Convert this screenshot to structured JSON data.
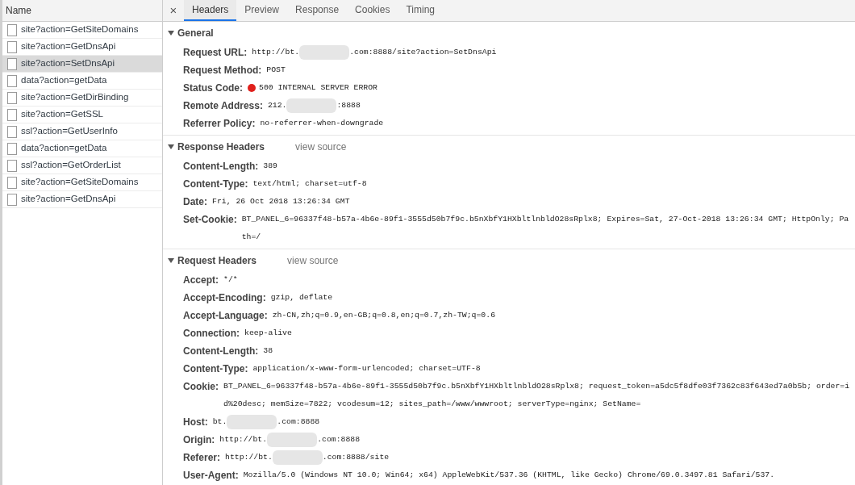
{
  "requests": {
    "header": "Name",
    "items": [
      {
        "name": "site?action=GetSiteDomains",
        "selected": false
      },
      {
        "name": "site?action=GetDnsApi",
        "selected": false
      },
      {
        "name": "site?action=SetDnsApi",
        "selected": true
      },
      {
        "name": "data?action=getData",
        "selected": false
      },
      {
        "name": "site?action=GetDirBinding",
        "selected": false
      },
      {
        "name": "site?action=GetSSL",
        "selected": false
      },
      {
        "name": "ssl?action=GetUserInfo",
        "selected": false
      },
      {
        "name": "data?action=getData",
        "selected": false
      },
      {
        "name": "ssl?action=GetOrderList",
        "selected": false
      },
      {
        "name": "site?action=GetSiteDomains",
        "selected": false
      },
      {
        "name": "site?action=GetDnsApi",
        "selected": false
      }
    ]
  },
  "close": "×",
  "tabs": [
    {
      "label": "Headers",
      "selected": true
    },
    {
      "label": "Preview",
      "selected": false
    },
    {
      "label": "Response",
      "selected": false
    },
    {
      "label": "Cookies",
      "selected": false
    },
    {
      "label": "Timing",
      "selected": false
    }
  ],
  "sections": [
    {
      "title": "General",
      "expanded": true,
      "headers": [
        {
          "name": "Request URL:",
          "parts": [
            "http://bt.",
            ".com:8888/site?action=SetDnsApi"
          ]
        },
        {
          "name": "Request Method:",
          "parts": [
            "POST"
          ]
        },
        {
          "name": "Status Code:",
          "color": "#e0201c",
          "parts": [
            "500 INTERNAL SERVER ERROR"
          ]
        },
        {
          "name": "Remote Address:",
          "parts": [
            "212.",
            ":8888"
          ]
        },
        {
          "name": "Referrer Policy:",
          "parts": [
            "no-referrer-when-downgrade"
          ]
        }
      ]
    },
    {
      "title": "Response Headers",
      "link": "view source",
      "expanded": true,
      "headers": [
        {
          "name": "Content-Length:",
          "parts": [
            "389"
          ]
        },
        {
          "name": "Content-Type:",
          "parts": [
            "text/html; charset=utf-8"
          ]
        },
        {
          "name": "Date:",
          "parts": [
            "Fri, 26 Oct 2018 13:26:34 GMT"
          ]
        },
        {
          "name": "Set-Cookie:",
          "parts": [
            "BT_PANEL_6=96337f48-b57a-4b6e-89f1-3555d50b7f9c.b5nXbfY1HXbltlnbldO28sRplx8; Expires=Sat, 27-Oct-2018 13:26:34 GMT; HttpOnly; Path=/"
          ]
        }
      ]
    },
    {
      "title": "Request Headers",
      "link": "view source",
      "expanded": true,
      "headers": [
        {
          "name": "Accept:",
          "parts": [
            "*/*"
          ]
        },
        {
          "name": "Accept-Encoding:",
          "parts": [
            "gzip, deflate"
          ]
        },
        {
          "name": "Accept-Language:",
          "parts": [
            "zh-CN,zh;q=0.9,en-GB;q=0.8,en;q=0.7,zh-TW;q=0.6"
          ]
        },
        {
          "name": "Connection:",
          "parts": [
            "keep-alive"
          ]
        },
        {
          "name": "Content-Length:",
          "parts": [
            "38"
          ]
        },
        {
          "name": "Content-Type:",
          "parts": [
            "application/x-www-form-urlencoded; charset=UTF-8"
          ]
        },
        {
          "name": "Cookie:",
          "parts": [
            "BT_PANEL_6=96337f48-b57a-4b6e-89f1-3555d50b7f9c.b5nXbfY1HXbltlnbldO28sRplx8; request_token=a5dc5f8dfe03f7362c83f643ed7a0b5b; order=id%20desc; memSize=7822; vcodesum=12; sites_path=/www/wwwroot; serverType=nginx; SetName="
          ]
        },
        {
          "name": "Host:",
          "parts": [
            "bt.",
            ".com:8888"
          ]
        },
        {
          "name": "Origin:",
          "parts": [
            "http://bt.",
            ".com:8888"
          ]
        },
        {
          "name": "Referer:",
          "parts": [
            "http://bt.",
            ".com:8888/site"
          ]
        },
        {
          "name": "User-Agent:",
          "parts": [
            "Mozilla/5.0 (Windows NT 10.0; Win64; x64) AppleWebKit/537.36 (KHTML, like Gecko) Chrome/69.0.3497.81 Safari/537."
          ]
        }
      ]
    }
  ]
}
